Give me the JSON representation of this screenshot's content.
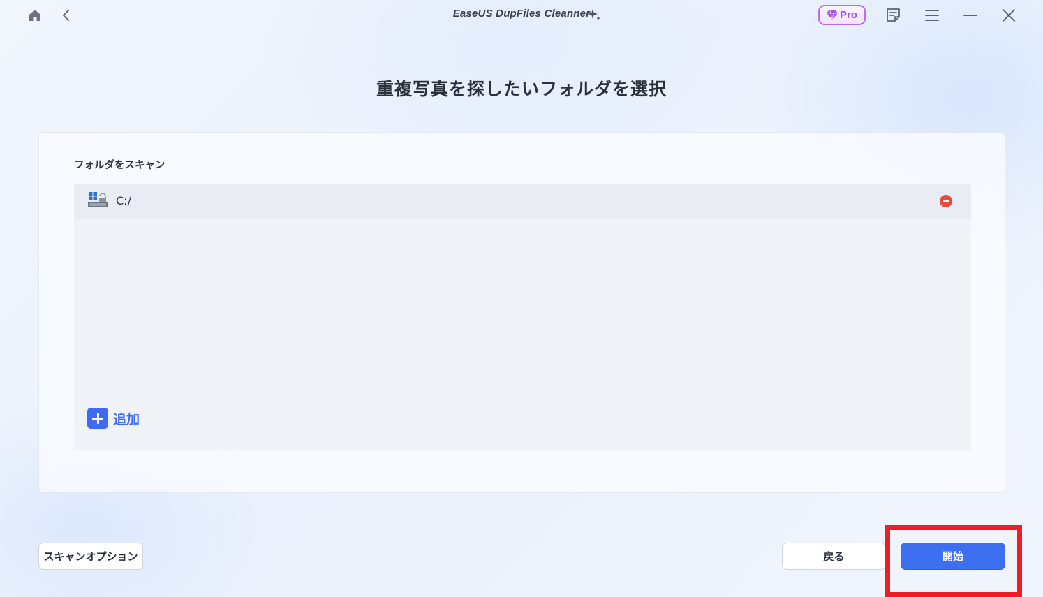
{
  "window": {
    "title": "EaseUS DupFiles Cleanner",
    "pro_badge": "Pro",
    "icons": [
      "home-icon",
      "back-icon",
      "sparkle-icon",
      "diamond-icon",
      "feedback-icon",
      "menu-icon",
      "minimize-icon",
      "close-icon"
    ]
  },
  "page": {
    "heading": "重複写真を探したいフォルダを選択"
  },
  "scan": {
    "label": "フォルダをスキャン",
    "folders": [
      {
        "path": "C:/",
        "icon": "windows-drive-icon"
      }
    ],
    "add_label": "追加"
  },
  "footer": {
    "scan_options_label": "スキャンオプション",
    "back_label": "戻る",
    "start_label": "開始"
  },
  "colors": {
    "accent": "#3d6ff1",
    "pro": "#a24fe3",
    "remove": "#e84a3b",
    "highlight": "#ee1e26"
  }
}
